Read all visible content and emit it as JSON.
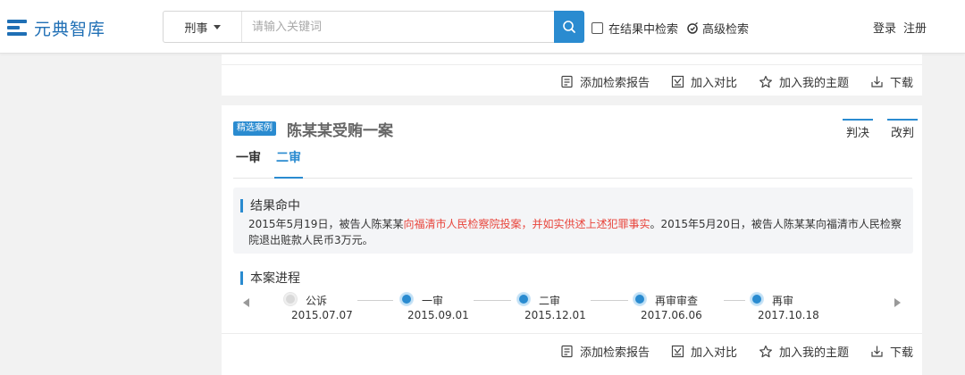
{
  "header": {
    "logo_text": "元典智库",
    "search": {
      "type_label": "刑事",
      "placeholder": "请输入关键词"
    },
    "in_result_label": "在结果中检索",
    "advanced_label": "高级检索",
    "login_label": "登录",
    "register_label": "注册"
  },
  "actions": {
    "add_report": "添加检索报告",
    "compare": "加入对比",
    "add_topic": "加入我的主题",
    "download": "下载"
  },
  "case": {
    "badge": "精选案例",
    "title": "陈某某受贿一案",
    "verdict_links": [
      "判决",
      "改判"
    ],
    "tabs": [
      "一审",
      "二审"
    ],
    "active_tab": "二审",
    "result_heading": "结果命中",
    "result_text_pre": "2015年5月19日，被告人陈某某",
    "result_text_highlight": "向福清市人民检察院投案，并如实供述上述犯罪事实",
    "result_text_post": "。2015年5月20日，被告人陈某某向福清市人民检察院退出赃款人民币3万元。",
    "progress_heading": "本案进程",
    "timeline": [
      {
        "label": "公诉",
        "date": "2015.07.07",
        "state": "inactive"
      },
      {
        "label": "一审",
        "date": "2015.09.01",
        "state": "active"
      },
      {
        "label": "二审",
        "date": "2015.12.01",
        "state": "active"
      },
      {
        "label": "再审审查",
        "date": "2017.06.06",
        "state": "active"
      },
      {
        "label": "再审",
        "date": "2017.10.18",
        "state": "active"
      }
    ]
  },
  "colors": {
    "accent": "#2a8bd0",
    "highlight": "#e8453c",
    "logo": "#1f6fb5"
  }
}
